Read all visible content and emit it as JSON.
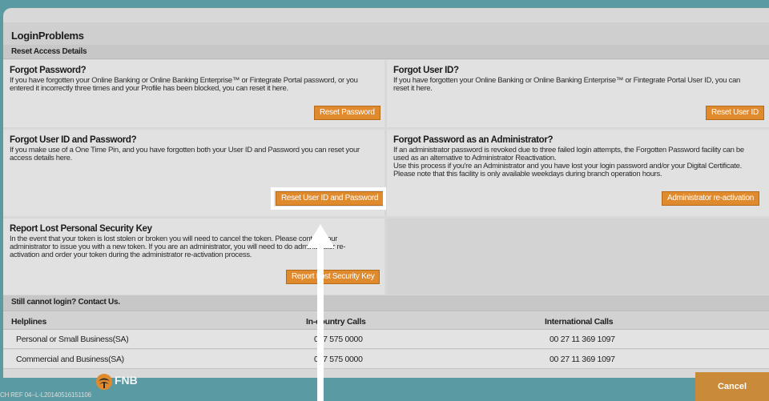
{
  "title": "LoginProblems",
  "reset_section_title": "Reset Access Details",
  "forgot_password": {
    "heading": "Forgot Password?",
    "text": "If you have forgotten your Online Banking or Online Banking Enterprise™ or Fintegrate Portal password, or you\nentered it incorrectly three times and your Profile has been blocked, you can reset it here.",
    "button": "Reset Password"
  },
  "forgot_userid": {
    "heading": "Forgot User ID?",
    "text": "If you have forgotten your Online Banking or Online Banking Enterprise™ or Fintegrate Portal User ID, you can\nreset it here.",
    "button": "Reset User ID"
  },
  "forgot_both": {
    "heading": "Forgot User ID and Password?",
    "text": "If you make use of a One Time Pin, and you have forgotten both your User ID and Password you can reset your\naccess details here.",
    "button": "Reset User ID and Password"
  },
  "forgot_admin": {
    "heading": "Forgot Password as an Administrator?",
    "text": "If an administrator password is revoked due to three failed login attempts, the Forgotten Password facility can be\nused as an alternative to Administrator Reactivation.\nUse this process if you're an Administrator and you have lost your login password and/or your Digital Certificate.\nPlease note that this facility is only available weekdays during branch operation hours.",
    "button": "Administrator re-activation"
  },
  "lost_key": {
    "heading": "Report Lost Personal Security Key",
    "text": "In the event that your token is lost stolen or broken you will need to cancel the token. Please contact your\nadministrator to issue you with a new token. If you are an administrator, you will need to do administrator re-\nactivation and order your token during the administrator re-activation process.",
    "button": "Report Lost Security Key"
  },
  "contact_section_title": "Still cannot login? Contact Us.",
  "helplines": {
    "headers": [
      "Helplines",
      "In-country Calls",
      "International Calls"
    ],
    "rows": [
      [
        "Personal or Small Business(SA)",
        "087 575 0000",
        "00 27 11 369 1097"
      ],
      [
        "Commercial and Business(SA)",
        "087 575 0000",
        "00 27 11 369 1097"
      ]
    ]
  },
  "footer_ref": "CH REF 04--L-L20140516151106",
  "logo_text": "FNB",
  "cancel_label": "Cancel",
  "colors": {
    "accent": "#e08a2e",
    "background": "#0e6b6e",
    "panel": "#d8d8d8"
  },
  "annotation": "highlight-arrow-pointing-up"
}
